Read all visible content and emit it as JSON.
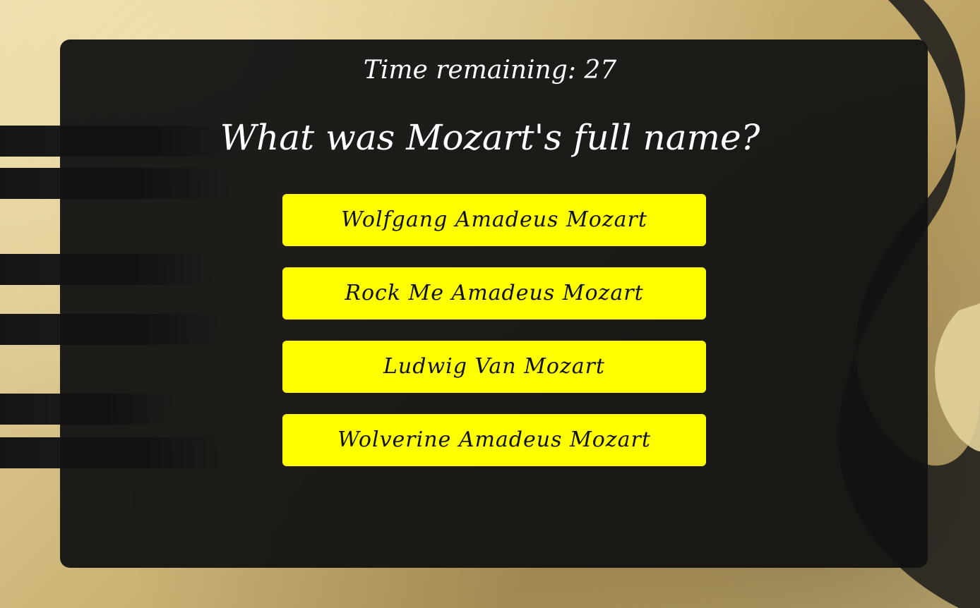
{
  "quiz": {
    "timer_text": "Time remaining: 27",
    "question": "What was Mozart's full name?",
    "answers": [
      {
        "label": "Wolfgang Amadeus Mozart"
      },
      {
        "label": "Rock Me Amadeus Mozart"
      },
      {
        "label": "Ludwig Van Mozart"
      },
      {
        "label": "Wolverine Amadeus Mozart"
      }
    ]
  },
  "colors": {
    "panel": "#121212",
    "answer_button": "#ffff00",
    "text_light": "#ffffff",
    "text_dark": "#111111"
  }
}
